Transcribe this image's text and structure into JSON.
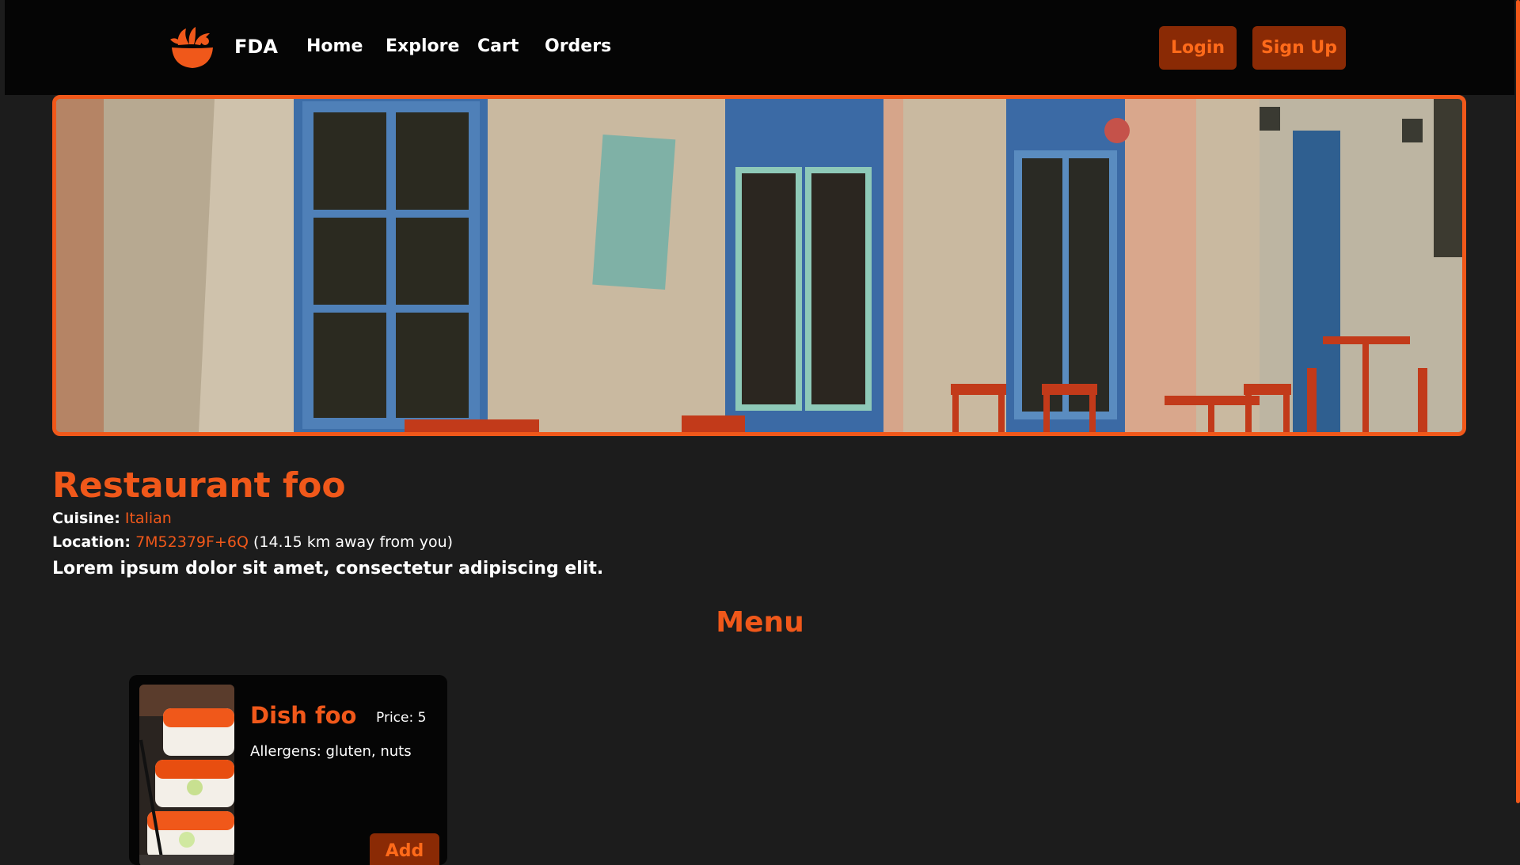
{
  "navbar": {
    "brand": "FDA",
    "links": [
      "Home",
      "Explore",
      "Cart",
      "Orders"
    ],
    "login_label": "Login",
    "signup_label": "Sign Up"
  },
  "colors": {
    "accent": "#f0581a",
    "button_bg": "#8a2a05",
    "background": "#1c1c1c",
    "navbar_bg": "#050505"
  },
  "restaurant": {
    "name": "Restaurant foo",
    "cuisine_label": "Cuisine:",
    "cuisine": "Italian",
    "location_label": "Location:",
    "location_code": "7M52379F+6Q",
    "distance": "(14.15 km away from you)",
    "description": "Lorem ipsum dolor sit amet, consectetur adipiscing elit."
  },
  "menu": {
    "heading": "Menu",
    "dishes": [
      {
        "name": "Dish foo",
        "price": "Price: 5",
        "allergens": "Allergens: gluten, nuts",
        "add_label": "Add"
      }
    ]
  },
  "icons": {
    "logo": "food-bowl-icon"
  }
}
